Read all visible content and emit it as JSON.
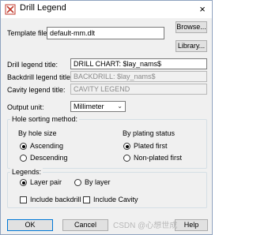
{
  "window": {
    "title": "Drill Legend",
    "close_glyph": "×",
    "icon": "drill-legend-icon"
  },
  "template_file": {
    "label": "Template file:",
    "value": "default-mm.dlt",
    "browse_label": "Browse...",
    "library_label": "Library..."
  },
  "drill_legend_title": {
    "label": "Drill legend title:",
    "value": "DRILL CHART: $lay_nams$"
  },
  "backdrill_legend_title": {
    "label": "Backdrill legend title:",
    "value": "BACKDRILL: $lay_nams$"
  },
  "cavity_legend_title": {
    "label": "Cavity legend title:",
    "value": "CAVITY LEGEND"
  },
  "output_unit": {
    "label": "Output unit:",
    "value": "Millimeter"
  },
  "hole_sorting": {
    "title": "Hole sorting method:",
    "by_hole_size_label": "By hole size",
    "ascending_label": "Ascending",
    "descending_label": "Descending",
    "by_plating_status_label": "By plating status",
    "plated_first_label": "Plated first",
    "non_plated_first_label": "Non-plated first",
    "ascending_checked": true,
    "plated_first_checked": true
  },
  "legends": {
    "title": "Legends:",
    "layer_pair_label": "Layer pair",
    "by_layer_label": "By layer",
    "include_backdrill_label": "Include backdrill",
    "include_cavity_label": "Include Cavity",
    "layer_pair_checked": true
  },
  "footer": {
    "ok_label": "OK",
    "cancel_label": "Cancel",
    "help_label": "Help"
  },
  "watermark": "CSDN @心想世成"
}
